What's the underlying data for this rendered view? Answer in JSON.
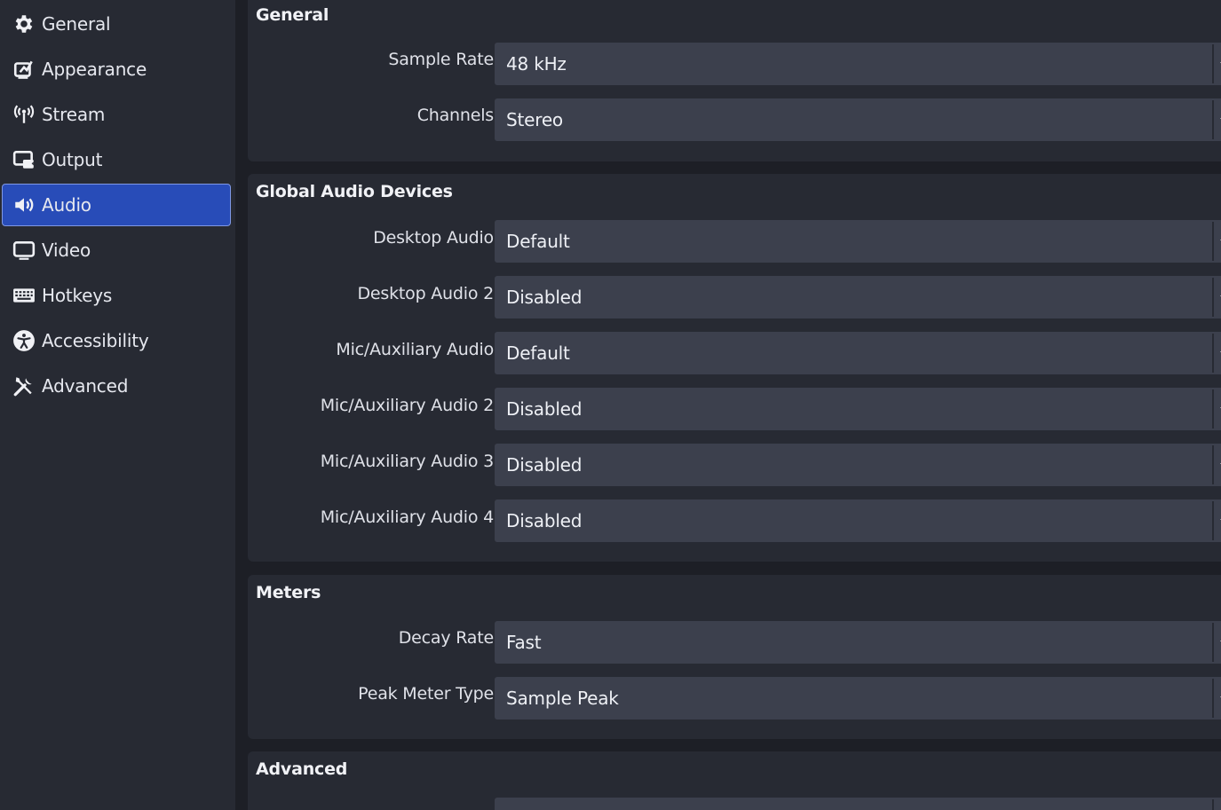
{
  "sidebar": {
    "items": [
      {
        "label": "General",
        "icon": "gear-icon"
      },
      {
        "label": "Appearance",
        "icon": "appearance-icon"
      },
      {
        "label": "Stream",
        "icon": "broadcast-icon"
      },
      {
        "label": "Output",
        "icon": "output-icon"
      },
      {
        "label": "Audio",
        "icon": "speaker-icon",
        "active": true
      },
      {
        "label": "Video",
        "icon": "monitor-icon"
      },
      {
        "label": "Hotkeys",
        "icon": "keyboard-icon"
      },
      {
        "label": "Accessibility",
        "icon": "accessibility-icon"
      },
      {
        "label": "Advanced",
        "icon": "tools-icon"
      }
    ]
  },
  "general": {
    "title": "General",
    "sample_rate": {
      "label": "Sample Rate",
      "value": "48 kHz"
    },
    "channels": {
      "label": "Channels",
      "value": "Stereo"
    }
  },
  "devices": {
    "title": "Global Audio Devices",
    "desktop_audio": {
      "label": "Desktop Audio",
      "value": "Default"
    },
    "desktop_audio_2": {
      "label": "Desktop Audio 2",
      "value": "Disabled"
    },
    "mic_aux": {
      "label": "Mic/Auxiliary Audio",
      "value": "Default"
    },
    "mic_aux_2": {
      "label": "Mic/Auxiliary Audio 2",
      "value": "Disabled"
    },
    "mic_aux_3": {
      "label": "Mic/Auxiliary Audio 3",
      "value": "Disabled"
    },
    "mic_aux_4": {
      "label": "Mic/Auxiliary Audio 4",
      "value": "Disabled"
    }
  },
  "meters": {
    "title": "Meters",
    "decay_rate": {
      "label": "Decay Rate",
      "value": "Fast"
    },
    "peak_meter_type": {
      "label": "Peak Meter Type",
      "value": "Sample Peak"
    }
  },
  "advanced": {
    "title": "Advanced"
  },
  "colors": {
    "background": "#1d1f26",
    "panel": "#272a33",
    "field": "#3c404d",
    "active": "#284cb8"
  }
}
